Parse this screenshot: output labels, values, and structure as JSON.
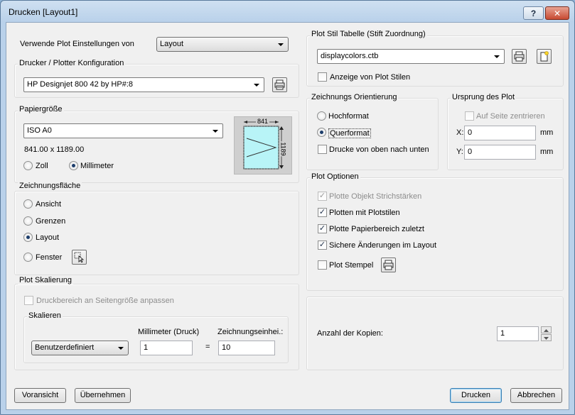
{
  "window": {
    "title": "Drucken [Layout1]",
    "help_label": "?",
    "close_label": "✕"
  },
  "plot_settings": {
    "label": "Verwende Plot Einstellungen von",
    "value": "Layout"
  },
  "printer": {
    "group_label": "Drucker / Plotter Konfiguration",
    "value": "HP Designjet 800 42 by HP#:8"
  },
  "paper": {
    "group_label": "Papiergröße",
    "value": "ISO A0",
    "size_text": "841.00 x 1189.00",
    "unit_zoll": "Zoll",
    "unit_mm": "Millimeter",
    "preview_width": "841",
    "preview_height": "1189"
  },
  "area": {
    "group_label": "Zeichnungsfläche",
    "options": [
      "Ansicht",
      "Grenzen",
      "Layout",
      "Fenster"
    ],
    "selected": "Layout"
  },
  "scaling": {
    "group_label": "Plot Skalierung",
    "fit_label": "Druckbereich an Seitengröße anpassen",
    "scale_group_label": "Skalieren",
    "scale_value": "Benutzerdefiniert",
    "mm_label": "Millimeter (Druck)",
    "mm_value": "1",
    "equals": "=",
    "units_label": "Zeichnungseinhei.:",
    "units_value": "10"
  },
  "plotstyle": {
    "group_label": "Plot Stil Tabelle (Stift Zuordnung)",
    "value": "displaycolors.ctb",
    "show_label": "Anzeige von Plot Stilen"
  },
  "orientation": {
    "group_label": "Zeichnungs Orientierung",
    "portrait": "Hochformat",
    "landscape": "Querformat",
    "upside_down": "Drucke von oben nach unten"
  },
  "origin": {
    "group_label": "Ursprung des Plot",
    "center_label": "Auf Seite zentrieren",
    "x_label": "X:",
    "x_value": "0",
    "y_label": "Y:",
    "y_value": "0",
    "unit": "mm"
  },
  "options": {
    "group_label": "Plot Optionen",
    "lineweights": "Plotte Objekt Strichstärken",
    "with_styles": "Plotten mit Plotstilen",
    "paper_last": "Plotte Papierbereich zuletzt",
    "save_changes": "Sichere Änderungen im Layout",
    "stamp": "Plot Stempel"
  },
  "copies": {
    "label": "Anzahl der Kopien:",
    "value": "1"
  },
  "footer": {
    "preview": "Voransicht",
    "apply": "Übernehmen",
    "print": "Drucken",
    "cancel": "Abbrechen"
  }
}
